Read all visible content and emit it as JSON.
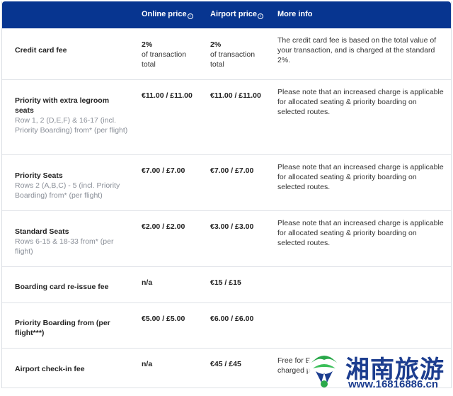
{
  "header": {
    "col1": "",
    "col2": "Online price",
    "col3": "Airport price",
    "col4": "More info",
    "info_glyph": "i"
  },
  "rows": [
    {
      "name": "Credit card fee",
      "sub": "",
      "online": "2%",
      "online_sub": "of transaction total",
      "airport": "2%",
      "airport_sub": "of transaction total",
      "info": "The credit card fee is based on the total value of your transaction, and is charged at the standard 2%."
    },
    {
      "name": "Priority with extra legroom seats",
      "sub": "Row 1, 2 (D,E,F) & 16-17 (incl. Priority Boarding) from* (per flight)",
      "online": "€11.00 / £11.00",
      "airport": "€11.00 / £11.00",
      "info": "Please note that an increased charge is applicable for allocated seating & priority boarding on selected routes."
    },
    {
      "name": "Priority Seats",
      "sub": "Rows 2 (A,B,C) - 5 (incl. Priority Boarding) from* (per flight)",
      "online": "€7.00 / £7.00",
      "airport": "€7.00 / £7.00",
      "info": "Please note that an increased charge is applicable for allocated seating & priority boarding on selected routes."
    },
    {
      "name": "Standard Seats",
      "sub": "Rows 6-15 & 18-33 from* (per flight)",
      "online": "€2.00 / £2.00",
      "airport": "€3.00 / £3.00",
      "info": "Please note that an increased charge is applicable for allocated seating & priority boarding on selected routes."
    },
    {
      "name": "Boarding card re-issue fee",
      "sub": "",
      "online": "n/a",
      "airport": "€15 / £15",
      "info": ""
    },
    {
      "name": "Priority Boarding from (per flight***)",
      "sub": "",
      "online": "€5.00 / £5.00",
      "airport": "€6.00 / £6.00",
      "info": ""
    },
    {
      "name": "Airport check-in fee",
      "sub": "",
      "online": "n/a",
      "airport": "€45 / £45",
      "info": "Free for E",
      "info_line2": "charged p"
    }
  ],
  "watermark": {
    "text": "湘南旅游",
    "url": "www.16816886.cn"
  },
  "colors": {
    "header_bg": "#073590",
    "border": "#dfe2e7",
    "sub_text": "#8a8f98",
    "watermark": "#1c3d8f"
  }
}
